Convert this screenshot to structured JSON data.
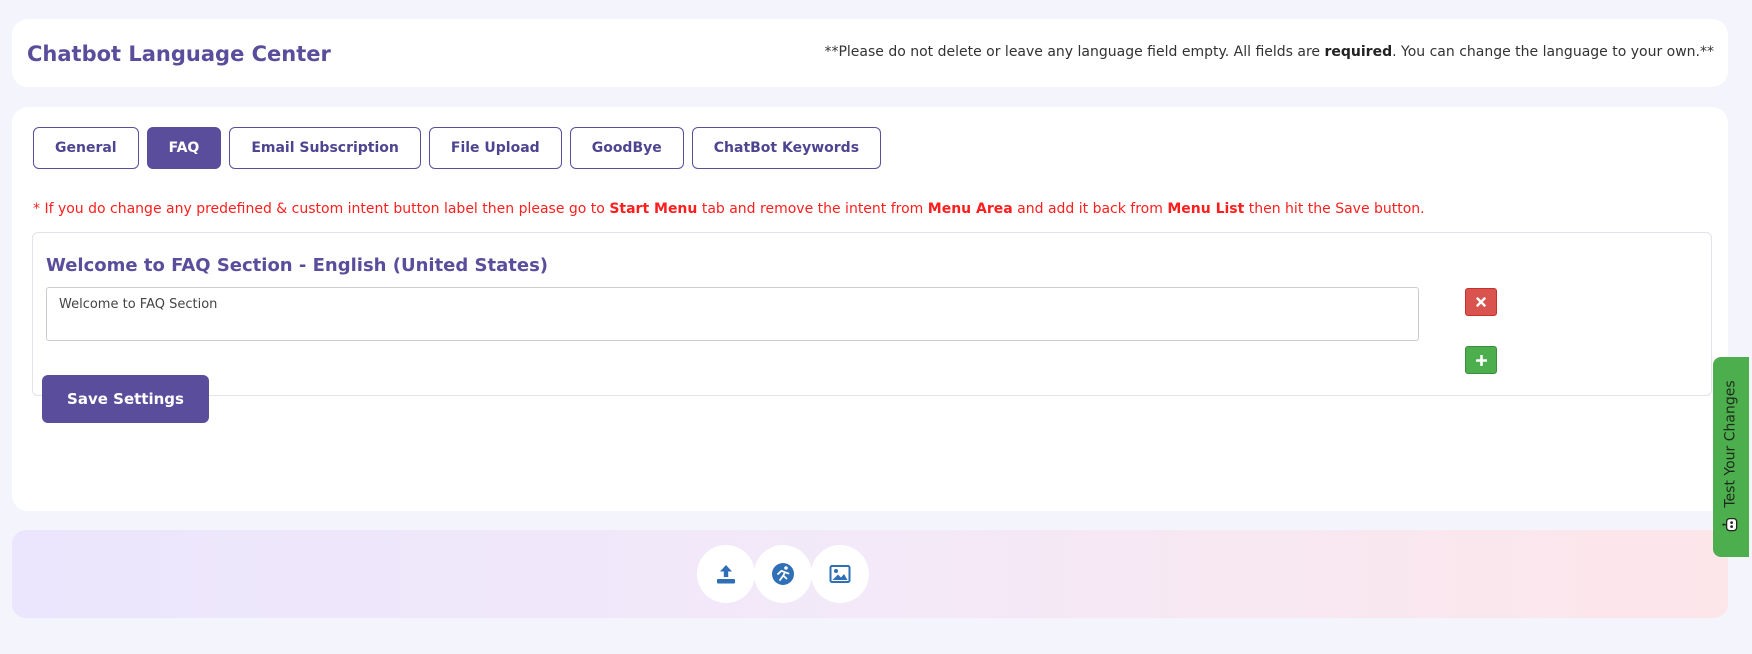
{
  "header": {
    "title": "Chatbot Language Center",
    "note_prefix": "**Please do not delete or leave any language field empty. All fields are ",
    "note_bold": "required",
    "note_suffix": ". You can change the language to your own.**"
  },
  "tabs": [
    {
      "label": "General",
      "active": false
    },
    {
      "label": "FAQ",
      "active": true
    },
    {
      "label": "Email Subscription",
      "active": false
    },
    {
      "label": "File Upload",
      "active": false
    },
    {
      "label": "GoodBye",
      "active": false
    },
    {
      "label": "ChatBot Keywords",
      "active": false
    }
  ],
  "warning": {
    "part1": "* If you do change any predefined & custom intent button label then please go to ",
    "bold1": "Start Menu",
    "part2": " tab and remove the intent from ",
    "bold2": "Menu Area",
    "part3": " and add it back from ",
    "bold3": "Menu List",
    "part4": " then hit the Save button."
  },
  "faq": {
    "title": "Welcome to FAQ Section - English (United States)",
    "field_value": "Welcome to FAQ Section",
    "remove_icon": "times-icon",
    "add_icon": "plus-icon"
  },
  "save_button_label": "Save Settings",
  "footer_icons": [
    "upload-icon",
    "running-person-icon",
    "image-icon"
  ],
  "test_tab": {
    "label": "Test Your Changes",
    "icon": "robot-icon"
  },
  "colors": {
    "accent": "#5a4e9c",
    "danger": "#d9534f",
    "success": "#4cae4c",
    "warning_text": "#ff1e1e",
    "icon_blue": "#2f6fb5"
  }
}
